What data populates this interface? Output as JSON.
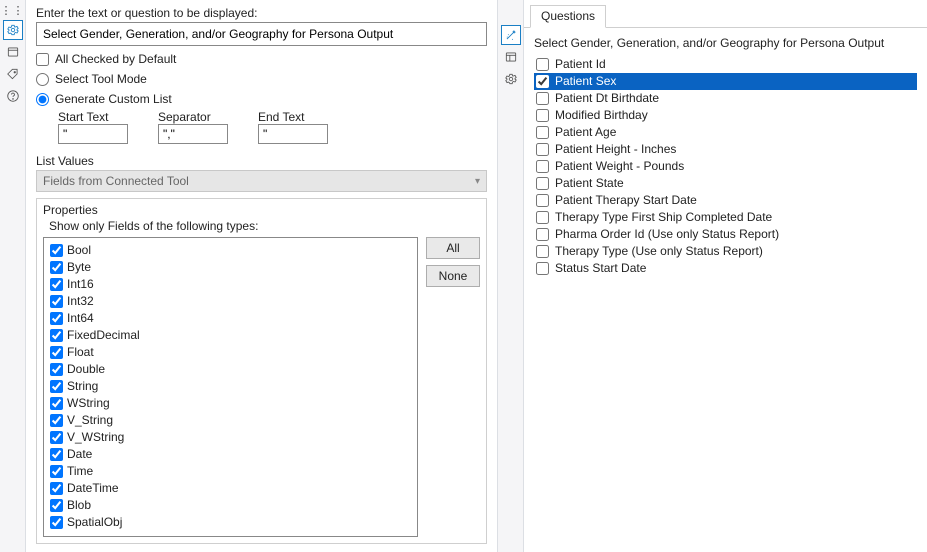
{
  "left": {
    "prompt_label": "Enter the text or question to be displayed:",
    "prompt_value": "Select Gender, Generation, and/or Geography for Persona Output",
    "all_checked_label": "All Checked by Default",
    "select_tool_mode_label": "Select Tool Mode",
    "generate_custom_list_label": "Generate Custom List",
    "start_text_label": "Start Text",
    "separator_label": "Separator",
    "end_text_label": "End Text",
    "start_text_value": "\"",
    "separator_value": "\",\"",
    "end_text_value": "\"",
    "list_values_label": "List Values",
    "combo_value": "Fields from Connected Tool",
    "properties_label": "Properties",
    "types_label": "Show only Fields of the following types:",
    "types": [
      "Bool",
      "Byte",
      "Int16",
      "Int32",
      "Int64",
      "FixedDecimal",
      "Float",
      "Double",
      "String",
      "WString",
      "V_String",
      "V_WString",
      "Date",
      "Time",
      "DateTime",
      "Blob",
      "SpatialObj"
    ],
    "btn_all": "All",
    "btn_none": "None"
  },
  "right": {
    "tab_label": "Questions",
    "prompt": "Select Gender, Generation, and/or Geography for Persona Output",
    "items": [
      {
        "label": "Patient Id",
        "checked": false,
        "selected": false
      },
      {
        "label": "Patient Sex",
        "checked": true,
        "selected": true
      },
      {
        "label": "Patient Dt Birthdate",
        "checked": false,
        "selected": false
      },
      {
        "label": "Modified Birthday",
        "checked": false,
        "selected": false
      },
      {
        "label": "Patient Age",
        "checked": false,
        "selected": false
      },
      {
        "label": "Patient Height - Inches",
        "checked": false,
        "selected": false
      },
      {
        "label": "Patient Weight - Pounds",
        "checked": false,
        "selected": false
      },
      {
        "label": "Patient State",
        "checked": false,
        "selected": false
      },
      {
        "label": "Patient Therapy Start Date",
        "checked": false,
        "selected": false
      },
      {
        "label": "Therapy Type First Ship Completed Date",
        "checked": false,
        "selected": false
      },
      {
        "label": "Pharma Order Id (Use only Status Report)",
        "checked": false,
        "selected": false
      },
      {
        "label": "Therapy Type (Use only Status Report)",
        "checked": false,
        "selected": false
      },
      {
        "label": "Status Start Date",
        "checked": false,
        "selected": false
      }
    ]
  }
}
